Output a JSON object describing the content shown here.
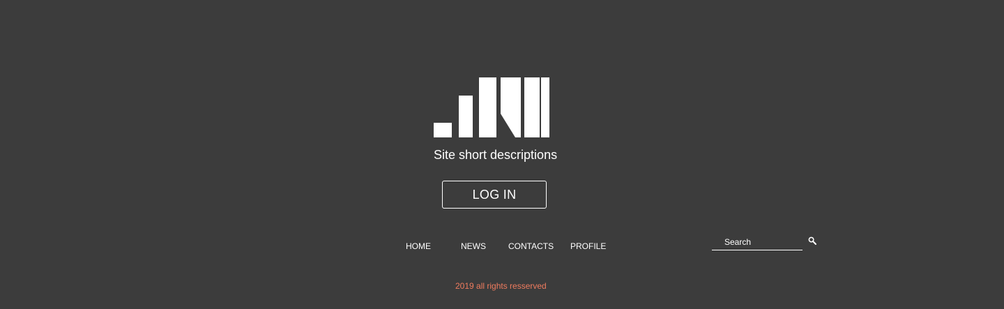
{
  "logo": {
    "name": "site-logo",
    "color": "#ffffff"
  },
  "header": {
    "tagline": "Site short descriptions"
  },
  "login": {
    "label": "LOG IN"
  },
  "nav": {
    "items": [
      {
        "label": "HOME"
      },
      {
        "label": "NEWS"
      },
      {
        "label": "CONTACTS"
      },
      {
        "label": "PROFILE"
      }
    ]
  },
  "search": {
    "placeholder": "Search",
    "icon": "search-icon"
  },
  "footer": {
    "copyright": "2019 all rights resserved",
    "copyright_color": "#ef7b5e"
  },
  "colors": {
    "background": "#3c3c3c",
    "text": "#ffffff",
    "accent": "#ef7b5e"
  }
}
